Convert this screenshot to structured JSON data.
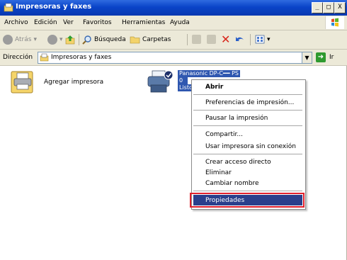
{
  "window": {
    "title": "Impresoras y faxes",
    "minimize": "_",
    "maximize": "□",
    "close": "X"
  },
  "menubar": {
    "items": [
      "Archivo",
      "Edición",
      "Ver",
      "Favoritos",
      "Herramientas",
      "Ayuda"
    ]
  },
  "toolbar": {
    "back": "Atrás",
    "search": "Búsqueda",
    "folders": "Carpetas"
  },
  "addressbar": {
    "label": "Dirección",
    "value": "Impresoras y faxes",
    "go": "Ir"
  },
  "content": {
    "add_printer": "Agregar impresora",
    "printer": {
      "name": "Panasonic DP-C━━ PS",
      "docs": "0",
      "status": "Listo"
    }
  },
  "context_menu": {
    "open": "Abrir",
    "print_prefs": "Preferencias de impresión...",
    "pause": "Pausar la impresión",
    "share": "Compartir...",
    "offline": "Usar impresora sin conexión",
    "shortcut": "Crear acceso directo",
    "delete": "Eliminar",
    "rename": "Cambiar nombre",
    "properties": "Propiedades"
  },
  "colors": {
    "titlebar": "#0a44c8",
    "selection": "#2a3f8c",
    "highlight_box": "#e0202c"
  }
}
